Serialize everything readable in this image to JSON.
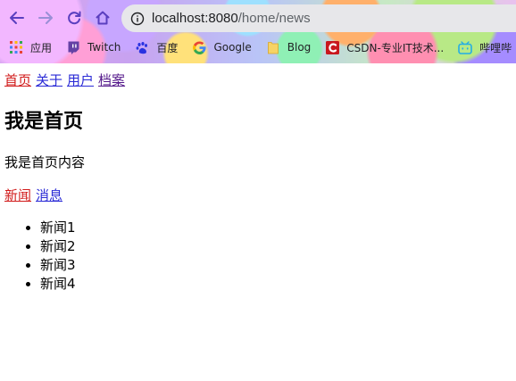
{
  "browser": {
    "url": {
      "host": "localhost:8080",
      "path": "/home/news"
    },
    "bookmarks": [
      {
        "label": "应用",
        "icon": "apps-grid-icon"
      },
      {
        "label": "Twitch",
        "icon": "twitch-icon"
      },
      {
        "label": "百度",
        "icon": "baidu-paw-icon"
      },
      {
        "label": "Google",
        "icon": "google-icon"
      },
      {
        "label": "Blog",
        "icon": "folder-icon"
      },
      {
        "label": "CSDN-专业IT技术...",
        "icon": "csdn-icon"
      },
      {
        "label": "哔哩哔",
        "icon": "bilibili-icon"
      }
    ],
    "colors": {
      "omnibox_bg": "#e7e7ea",
      "nav_icon": "#5a3fbf",
      "nav_icon_disabled": "#9a8fd6"
    }
  },
  "page": {
    "top_nav": [
      {
        "label": "首页",
        "state": "active"
      },
      {
        "label": "关于",
        "state": "normal"
      },
      {
        "label": "用户",
        "state": "normal"
      },
      {
        "label": "档案",
        "state": "visited"
      }
    ],
    "title": "我是首页",
    "description": "我是首页内容",
    "sub_nav": [
      {
        "label": "新闻",
        "state": "active"
      },
      {
        "label": "消息",
        "state": "normal"
      }
    ],
    "news_items": [
      "新闻1",
      "新闻2",
      "新闻3",
      "新闻4"
    ],
    "colors": {
      "link_active": "#d11a1a",
      "link_normal": "#2b2bd6",
      "link_visited": "#551a8b"
    }
  }
}
